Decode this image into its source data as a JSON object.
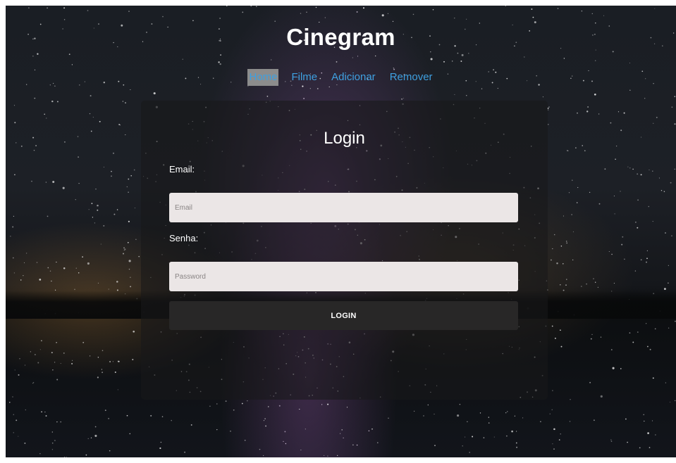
{
  "site": {
    "title": "Cinegram"
  },
  "nav": {
    "items": [
      {
        "label": "Home",
        "active": true
      },
      {
        "label": "Filme",
        "active": false
      },
      {
        "label": "Adicionar",
        "active": false
      },
      {
        "label": "Remover",
        "active": false
      }
    ]
  },
  "login": {
    "title": "Login",
    "email_label": "Email:",
    "email_placeholder": "Email",
    "email_value": "",
    "password_label": "Senha:",
    "password_placeholder": "Password",
    "password_value": "",
    "submit_label": "LOGIN"
  },
  "colors": {
    "nav_link": "#3ea0e0",
    "nav_active_bg": "#8c8c8c",
    "input_bg": "#ebe6e6",
    "button_bg": "#282727"
  }
}
